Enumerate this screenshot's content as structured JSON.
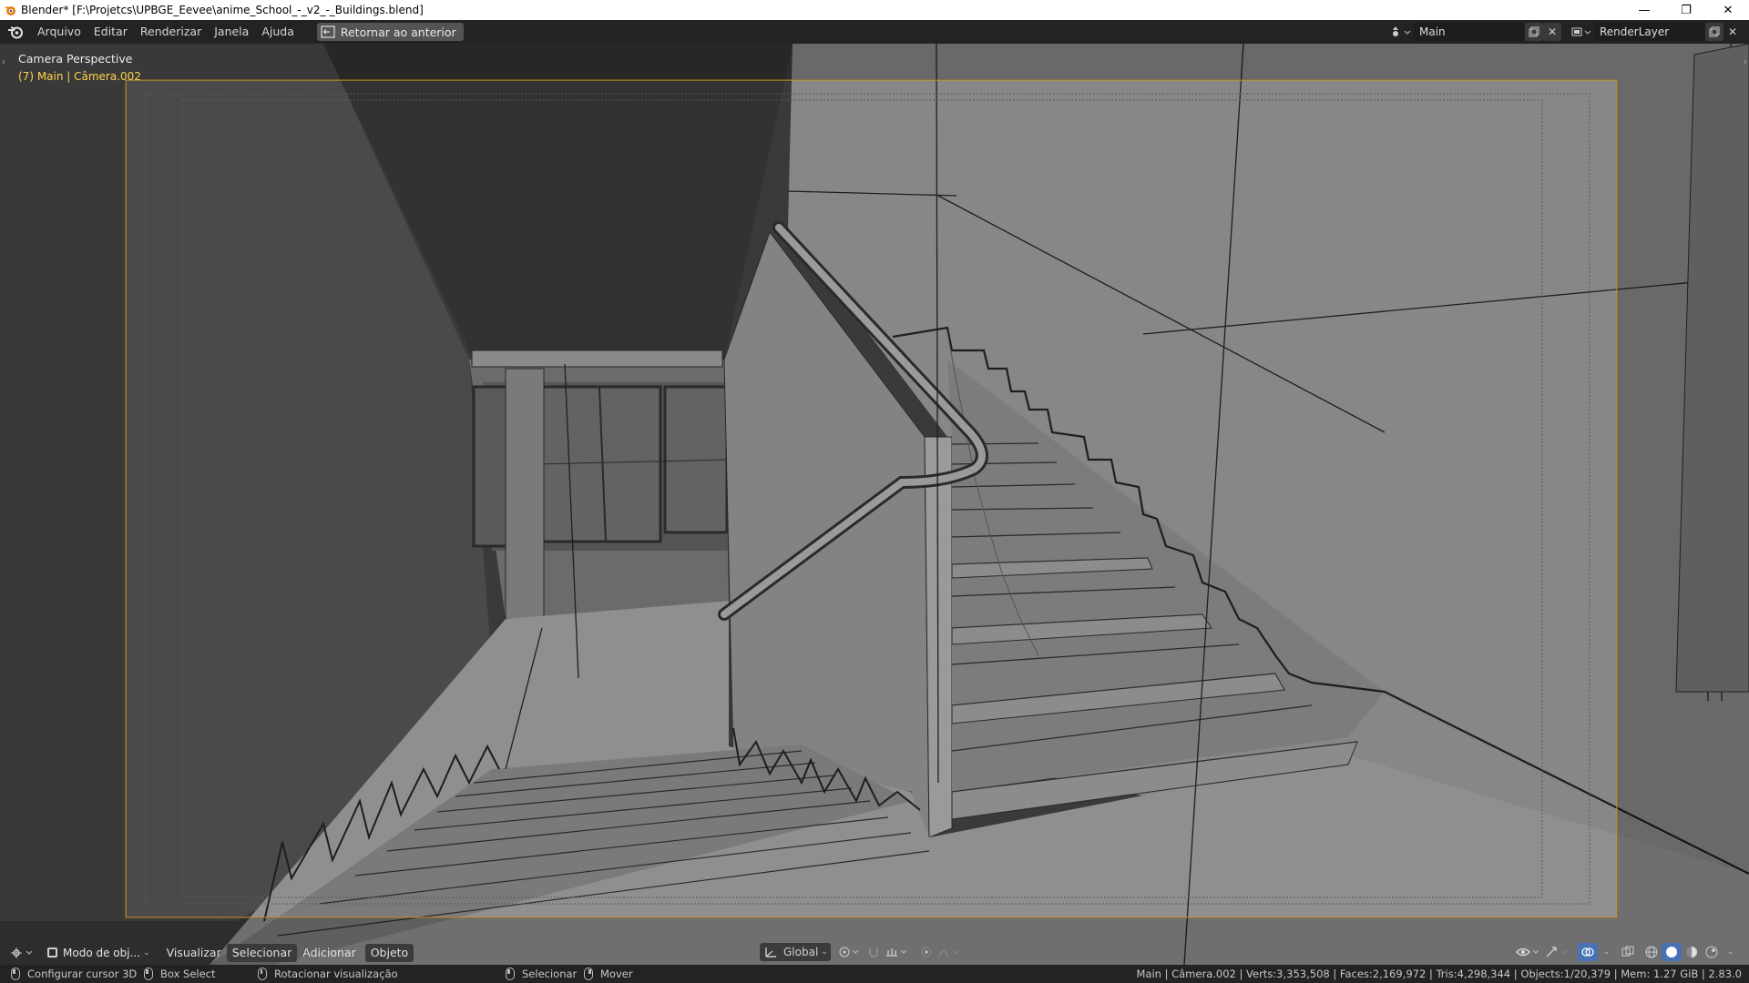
{
  "window": {
    "title": "Blender* [F:\\Projetcs\\UPBGE_Eevee\\anime_School_-_v2_-_Buildings.blend]",
    "controls": {
      "minimize": "—",
      "maximize": "❐",
      "close": "✕"
    }
  },
  "menubar": {
    "items": [
      "Arquivo",
      "Editar",
      "Renderizar",
      "Janela",
      "Ajuda"
    ],
    "back_button": "Retornar ao anterior",
    "scene_name": "Main",
    "view_layer": "RenderLayer"
  },
  "viewport": {
    "title": "Camera Perspective",
    "subtitle": "(7) Main | Câmera.002"
  },
  "viewport_header": {
    "mode": "Modo de obj...",
    "menus": [
      "Visualizar",
      "Selecionar",
      "Adicionar",
      "Objeto"
    ],
    "transform_orientation": "Global"
  },
  "statusbar": {
    "hints": [
      {
        "icon": "mouse-left",
        "label": "Configurar cursor 3D"
      },
      {
        "icon": "mouse-left",
        "label": "Box Select"
      },
      {
        "icon": "mouse-middle",
        "label": "Rotacionar visualização"
      },
      {
        "icon": "mouse-left",
        "label": "Selecionar"
      },
      {
        "icon": "mouse-right",
        "label": "Mover"
      }
    ],
    "stats": "Main | Câmera.002 | Verts:3,353,508 | Faces:2,169,972 | Tris:4,298,344 | Objects:1/20,379 | Mem: 1.27 GiB | 2.83.0"
  },
  "colors": {
    "accent": "#4772b3",
    "camera_frame": "#c8962a",
    "viewport_text_active": "#ffd24a"
  }
}
